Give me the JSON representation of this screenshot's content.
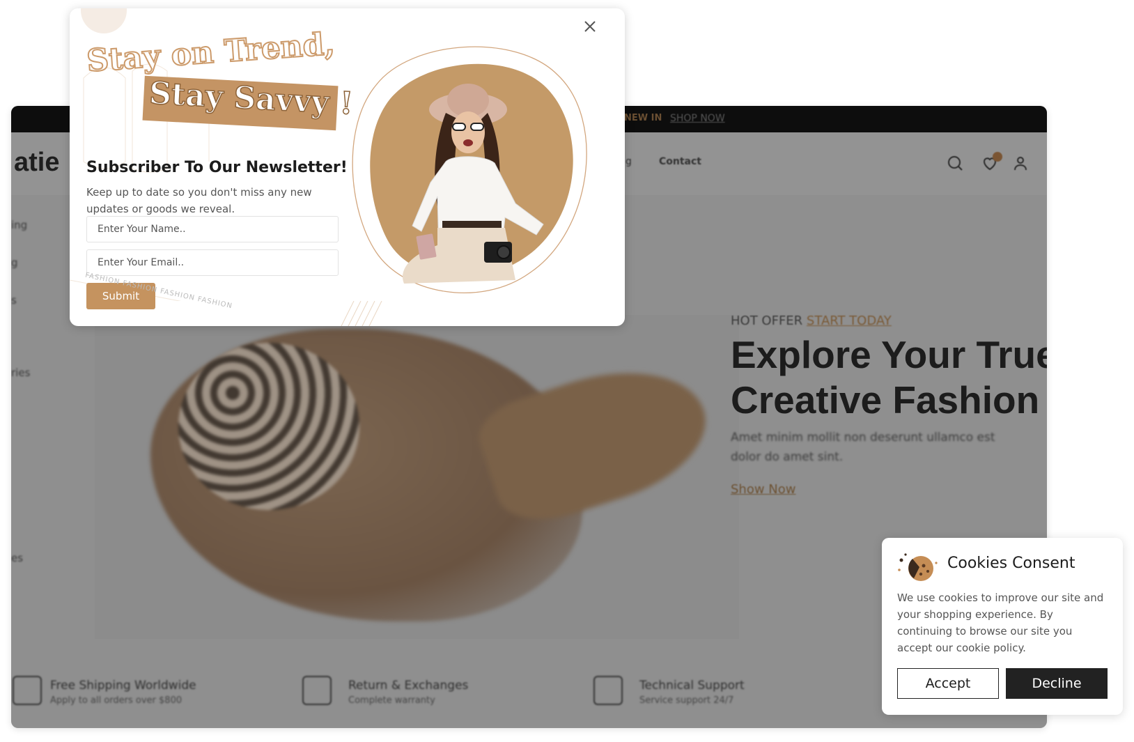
{
  "background_page": {
    "topbar": {
      "promo_text": "NEW IN",
      "shop_now": "SHOP NOW"
    },
    "logo_partial": "atie",
    "nav": {
      "partial_item": "g",
      "contact": "Contact"
    },
    "header_icons": [
      "search-icon",
      "heart-icon",
      "user-icon"
    ],
    "wishlist_count": "0",
    "sidebar_partial": [
      "ing",
      "g",
      "s",
      "ries",
      "es"
    ],
    "hero": {
      "tagline_prefix": "HOT OFFER",
      "tagline_link": "START TODAY",
      "title_line1": "Explore Your True",
      "title_line2": "Creative Fashion",
      "description_line1": "Amet minim mollit non deserunt ullamco est",
      "description_line2": "dolor do amet sint.",
      "cta": "Show Now"
    },
    "features": [
      {
        "title": "Free Shipping Worldwide",
        "subtitle": "Apply to all orders over $800"
      },
      {
        "title": "Return & Exchanges",
        "subtitle": "Complete warranty"
      },
      {
        "title": "Technical Support",
        "subtitle": "Service support 24/7"
      }
    ]
  },
  "newsletter": {
    "headline_1": "Stay on Trend,",
    "headline_2": "Stay Savvy !",
    "title": "Subscriber To Our Newsletter!",
    "description": "Keep up to date so you don't miss any new updates or goods we reveal.",
    "name_placeholder": "Enter Your Name..",
    "email_placeholder": "Enter Your Email..",
    "submit_label": "Submit",
    "decor_text": "FASHION   FASHION   FASHION   FASHION"
  },
  "cookies": {
    "title": "Cookies Consent",
    "text": "We use cookies to improve our site and your shopping experience. By continuing to browse our site you accept our cookie policy.",
    "accept_label": "Accept",
    "decline_label": "Decline"
  },
  "colors": {
    "accent": "#c5935f",
    "dark": "#222222",
    "overlay": "#8f8f8f"
  }
}
